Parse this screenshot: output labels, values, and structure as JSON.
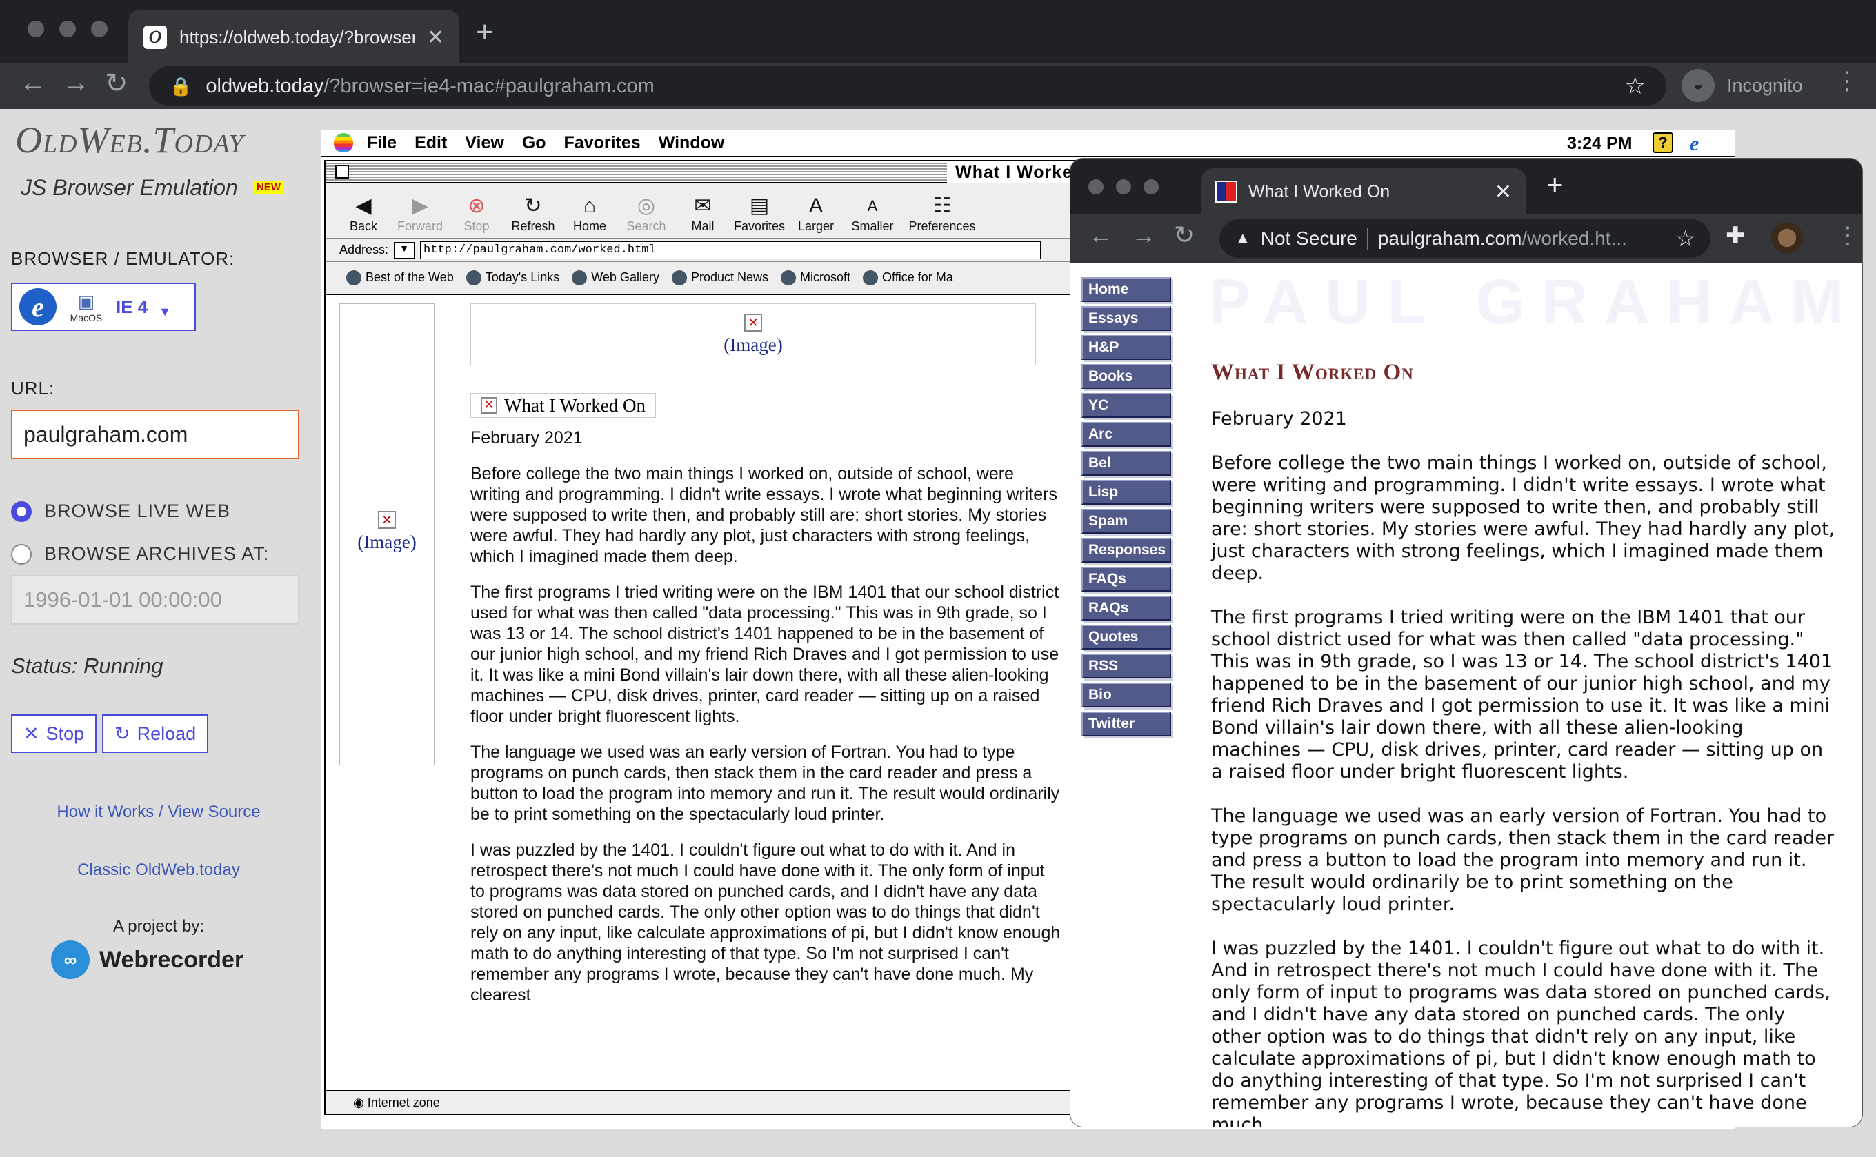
{
  "outer": {
    "tab_title": "https://oldweb.today/?browser",
    "url_host": "oldweb.today",
    "url_rest": "/?browser=ie4-mac#paulgraham.com",
    "incognito": "Incognito"
  },
  "sidebar": {
    "logo": "OldWeb.Today",
    "subtitle": "JS Browser Emulation",
    "new_badge": "NEW",
    "browser_label": "BROWSER / EMULATOR:",
    "browser_macos": "MacOS",
    "browser_name": "IE 4",
    "url_label": "URL:",
    "url_value": "paulgraham.com",
    "radio_live": "BROWSE LIVE WEB",
    "radio_archive": "BROWSE ARCHIVES AT:",
    "archive_date": "1996-01-01 00:00:00",
    "status": "Status: Running",
    "stop": "Stop",
    "reload": "Reload",
    "link_how": "How it Works / View Source",
    "link_classic": "Classic OldWeb.today",
    "project_by": "A project by:",
    "webrecorder": "Webrecorder"
  },
  "mac": {
    "menus": [
      "File",
      "Edit",
      "View",
      "Go",
      "Favorites",
      "Window"
    ],
    "clock": "3:24 PM",
    "ie_title": "What I Worked On",
    "toolbar": [
      "Back",
      "Forward",
      "Stop",
      "Refresh",
      "Home",
      "Search",
      "Mail",
      "Favorites",
      "Larger",
      "Smaller",
      "Preferences"
    ],
    "address_label": "Address:",
    "address": "http://paulgraham.com/worked.html",
    "links": [
      "Best of the Web",
      "Today's Links",
      "Web Gallery",
      "Product News",
      "Microsoft",
      "Office for Ma"
    ],
    "image_alt": "(Image)",
    "page_title_img": "What I Worked On",
    "date": "February 2021",
    "paras": [
      "Before college the two main things I worked on, outside of school, were writing and programming. I didn't write essays. I wrote what beginning writers were supposed to write then, and probably still are: short stories. My stories were awful. They had hardly any plot, just characters with strong feelings, which I imagined made them deep.",
      "The first programs I tried writing were on the IBM 1401 that our school district used for what was then called \"data processing.\" This was in 9th grade, so I was 13 or 14. The school district's 1401 happened to be in the basement of our junior high school, and my friend Rich Draves and I got permission to use it. It was like a mini Bond villain's lair down there, with all these alien-looking machines — CPU, disk drives, printer, card reader — sitting up on a raised floor under bright fluorescent lights.",
      "The language we used was an early version of Fortran. You had to type programs on punch cards, then stack them in the card reader and press a button to load the program into memory and run it. The result would ordinarily be to print something on the spectacularly loud printer.",
      "I was puzzled by the 1401. I couldn't figure out what to do with it. And in retrospect there's not much I could have done with it. The only form of input to programs was data stored on punched cards, and I didn't have any data stored on punched cards. The only other option was to do things that didn't rely on any input, like calculate approximations of pi, but I didn't know enough math to do anything interesting of that type. So I'm not surprised I can't remember any programs I wrote, because they can't have done much. My clearest"
    ],
    "status_zone": "Internet zone"
  },
  "inner": {
    "tab_title": "What I Worked On",
    "not_secure": "Not Secure",
    "url_host": "paulgraham.com",
    "url_rest": "/worked.ht...",
    "nav": [
      "Home",
      "Essays",
      "H&P",
      "Books",
      "YC",
      "Arc",
      "Bel",
      "Lisp",
      "Spam",
      "Responses",
      "FAQs",
      "RAQs",
      "Quotes",
      "RSS",
      "Bio",
      "Twitter"
    ],
    "banner": "PAUL GRAHAM",
    "heading": "What I Worked On",
    "date": "February 2021",
    "paras": [
      "Before college the two main things I worked on, outside of school, were writing and programming. I didn't write essays. I wrote what beginning writers were supposed to write then, and probably still are: short stories. My stories were awful. They had hardly any plot, just characters with strong feelings, which I imagined made them deep.",
      "The first programs I tried writing were on the IBM 1401 that our school district used for what was then called \"data processing.\" This was in 9th grade, so I was 13 or 14. The school district's 1401 happened to be in the basement of our junior high school, and my friend Rich Draves and I got permission to use it. It was like a mini Bond villain's lair down there, with all these alien-looking machines — CPU, disk drives, printer, card reader — sitting up on a raised floor under bright fluorescent lights.",
      "The language we used was an early version of Fortran. You had to type programs on punch cards, then stack them in the card reader and press a button to load the program into memory and run it. The result would ordinarily be to print something on the spectacularly loud printer.",
      "I was puzzled by the 1401. I couldn't figure out what to do with it. And in retrospect there's not much I could have done with it. The only form of input to programs was data stored on punched cards, and I didn't have any data stored on punched cards. The only other option was to do things that didn't rely on any input, like calculate approximations of pi, but I didn't know enough math to do anything interesting of that type. So I'm not surprised I can't remember any programs I wrote, because they can't have done much."
    ]
  }
}
